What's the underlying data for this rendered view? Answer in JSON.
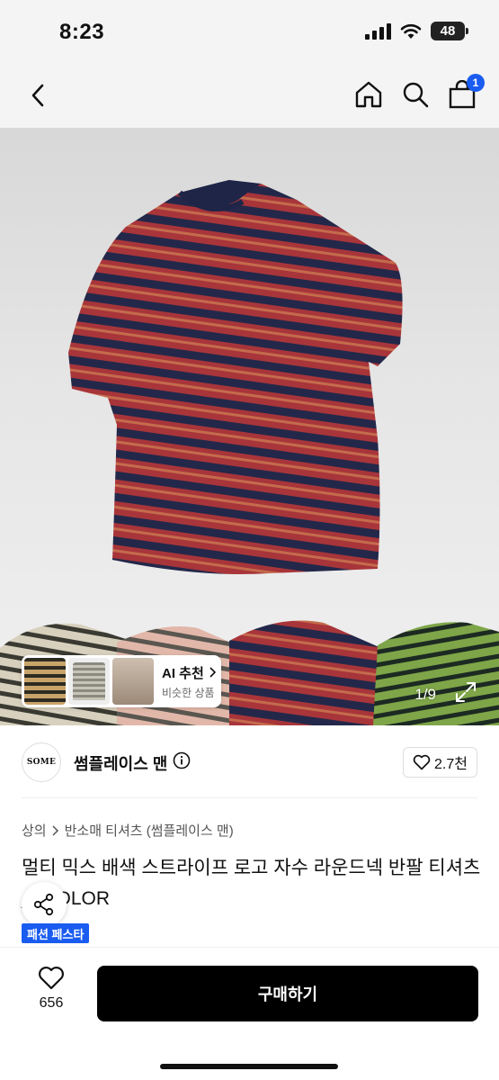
{
  "status_bar": {
    "time": "8:23",
    "battery": "48"
  },
  "nav": {
    "cart_count": "1"
  },
  "gallery": {
    "page_counter": "1/9",
    "ai_card": {
      "title": "AI 추천",
      "subtitle": "비슷한 상품"
    },
    "shirt_colors": {
      "stripe_red": "#a8353a",
      "stripe_navy": "#23284a",
      "collar": "#1f2547"
    }
  },
  "seller": {
    "logo_text": "SOME",
    "name": "썸플레이스 맨",
    "likes": "2.7천"
  },
  "product": {
    "breadcrumb": [
      "상의",
      "반소매 티셔츠 (썸플레이스 맨)"
    ],
    "title": "멀티 믹스 배색 스트라이프 로고 자수 라운드넥 반팔 티셔츠 _4COLOR",
    "promo_badge": "패션 페스타"
  },
  "bottom_bar": {
    "wish_count": "656",
    "buy_label": "구매하기"
  },
  "colors": {
    "accent": "#1a5cf0",
    "buy_button": "#000000"
  }
}
